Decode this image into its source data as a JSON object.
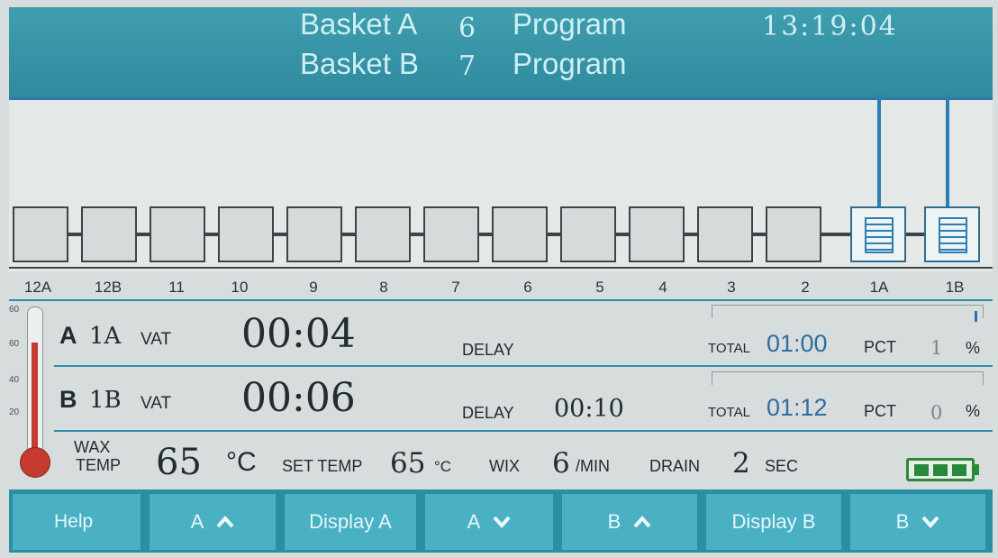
{
  "header": {
    "basket_a_label": "Basket A",
    "basket_a_program_num": "6",
    "basket_a_program_label": "Program",
    "basket_b_label": "Basket B",
    "basket_b_program_num": "7",
    "basket_b_program_label": "Program",
    "clock": "13:19:04"
  },
  "vats": [
    {
      "label": "12A"
    },
    {
      "label": "12B"
    },
    {
      "label": "11"
    },
    {
      "label": "10"
    },
    {
      "label": "9"
    },
    {
      "label": "8"
    },
    {
      "label": "7"
    },
    {
      "label": "6"
    },
    {
      "label": "5"
    },
    {
      "label": "4"
    },
    {
      "label": "3"
    },
    {
      "label": "2"
    },
    {
      "label": "1A"
    },
    {
      "label": "1B"
    }
  ],
  "basket_a": {
    "id": "A",
    "vat": "1A",
    "vat_unit": "VAT",
    "time": "00:04",
    "delay_label": "DELAY",
    "delay": "",
    "total_label": "TOTAL",
    "total": "01:00",
    "pct_label": "PCT",
    "pct": "1",
    "pct_unit": "%",
    "progress": 0.01
  },
  "basket_b": {
    "id": "B",
    "vat": "1B",
    "vat_unit": "VAT",
    "time": "00:06",
    "delay_label": "DELAY",
    "delay": "00:10",
    "total_label": "TOTAL",
    "total": "01:12",
    "pct_label": "PCT",
    "pct": "0",
    "pct_unit": "%",
    "progress": 0.0
  },
  "thermometer": {
    "ticks": [
      "60",
      "60",
      "40",
      "20"
    ]
  },
  "wax": {
    "label_line1": "WAX",
    "label_line2": "TEMP",
    "temp": "65",
    "temp_unit": "°C",
    "set_label": "SET TEMP",
    "set_temp": "65",
    "set_unit": "°C",
    "wix_label": "WIX",
    "wix_value": "6",
    "wix_unit": "/MIN",
    "drain_label": "DRAIN",
    "drain_value": "2",
    "drain_unit": "SEC"
  },
  "battery": {
    "cells_filled": 3,
    "cells_total": 3,
    "color": "#27893a"
  },
  "buttons": {
    "help": "Help",
    "a_up": "A",
    "display_a": "Display A",
    "a_down": "A",
    "b_up": "B",
    "display_b": "Display B",
    "b_down": "B"
  },
  "colors": {
    "header": "#2f8a9d",
    "button": "#4ab0c3",
    "accent_line": "#2b7fb3",
    "thermo_fill": "#c63b2f"
  }
}
